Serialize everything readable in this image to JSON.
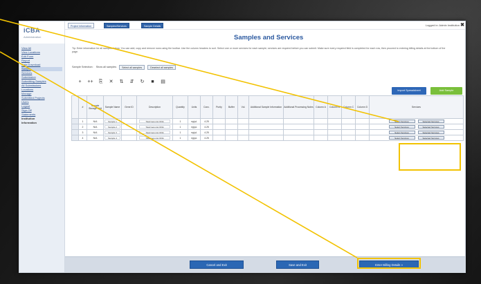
{
  "logo": {
    "name": "iCBA",
    "subtitle": "Administration"
  },
  "topbar": {
    "tabs": [
      "Project Information",
      "Samples/Services",
      "Sample Details"
    ],
    "right_text": "Logged in: Admin Institution",
    "close": "✖"
  },
  "sidebar": {
    "items": [
      {
        "label": "View All",
        "plain": false
      },
      {
        "label": "View Locations",
        "plain": false
      },
      {
        "label": "Edit Form",
        "plain": false
      },
      {
        "label": "Report",
        "plain": false
      },
      {
        "label": "Data Download",
        "plain": false
      },
      {
        "label": "Sample",
        "plain": false,
        "active": true
      },
      {
        "label": "Services",
        "plain": false
      },
      {
        "label": "Submission",
        "plain": false
      },
      {
        "label": "Submitting Samples",
        "plain": false
      },
      {
        "label": "All Submissions",
        "plain": false
      },
      {
        "label": "Locations",
        "plain": false
      },
      {
        "label": "Manage",
        "plain": false
      },
      {
        "label": "Submitted Projects",
        "plain": false
      },
      {
        "label": "Users",
        "plain": false
      },
      {
        "label": "Logout",
        "plain": false
      },
      {
        "label": "Sign-Off",
        "plain": false
      },
      {
        "label": "Statements",
        "plain": false
      },
      {
        "label": "Institution",
        "plain": true
      },
      {
        "label": "Information",
        "plain": true
      }
    ]
  },
  "page": {
    "title": "Samples and Services",
    "instructions": "Tip: Enter information for all samples below. You can add, copy and remove rows using the toolbar. Use the column headers to sort. Select one or more services for each sample; services are required before you can submit. Make sure every required field is completed for each row, then proceed to entering billing details at the bottom of the page.",
    "filter_label": "Sample Selection:",
    "filter_value": "Show all samples",
    "filter_buttons": [
      "Select all samples",
      "Deselect all samples"
    ]
  },
  "toolbar": {
    "icons": [
      "+",
      "++",
      "⎘",
      "✕",
      "⇅",
      "⇵",
      "↻",
      "■",
      "▤"
    ],
    "buttons": {
      "import": "Import Spreadsheet",
      "add": "Add Sample"
    }
  },
  "table": {
    "headers": [
      "",
      "#",
      "Sample Storage Unit",
      "Sample Name",
      "Gene ID",
      "Description",
      "Quantity",
      "Units",
      "Conc.",
      "Purity",
      "Buffer",
      "Vol.",
      "Additional Sample Information",
      "Additional Processing Notes",
      "Column A",
      "Column B",
      "Column C",
      "Column D",
      "Services"
    ],
    "rows": [
      {
        "num": "1",
        "unit": "N/A",
        "name": "Sample 1",
        "desc": "Total Genomic DNA",
        "qty": "1",
        "units": "ng/μL",
        "conc": "4.25"
      },
      {
        "num": "2",
        "unit": "N/A",
        "name": "Sample 2",
        "desc": "Total Genomic DNA",
        "qty": "1",
        "units": "ng/μL",
        "conc": "4.25"
      },
      {
        "num": "3",
        "unit": "N/A",
        "name": "Sample 3",
        "desc": "Total Genomic DNA",
        "qty": "1",
        "units": "ng/μL",
        "conc": "4.25"
      },
      {
        "num": "4",
        "unit": "N/A",
        "name": "Sample 4",
        "desc": "Total Genomic DNA",
        "qty": "1",
        "units": "ng/μL",
        "conc": "4.25"
      }
    ],
    "service_buttons": [
      "Select Services",
      "Selected Services"
    ]
  },
  "bottom": {
    "cancel": "Cancel and Exit",
    "save": "Save and Exit",
    "billing": "Enter Billing Details »"
  },
  "colors": {
    "highlight": "#f2c200",
    "primary": "#2b67b4",
    "green": "#7abf3b",
    "title": "#2c5aa0"
  }
}
